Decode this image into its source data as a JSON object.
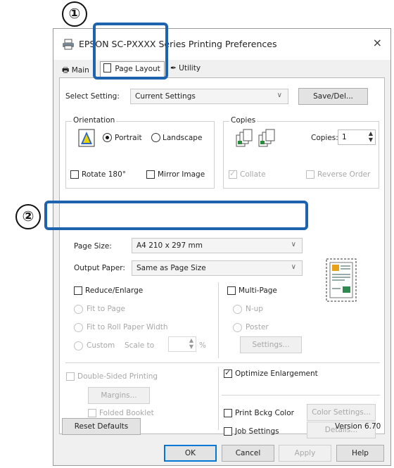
{
  "callouts": {
    "one": "①",
    "two": "②"
  },
  "window": {
    "title": "EPSON SC-PXXXX Series Printing Preferences",
    "close": "×"
  },
  "tabs": [
    {
      "label": "Main"
    },
    {
      "label": "Page Layout"
    },
    {
      "label": "Utility"
    }
  ],
  "select_setting": {
    "label": "Select Setting:",
    "value": "Current Settings",
    "save_button": "Save/Del..."
  },
  "orientation": {
    "title": "Orientation",
    "portrait": "Portrait",
    "landscape": "Landscape",
    "rotate": "Rotate 180°",
    "mirror": "Mirror Image"
  },
  "copies": {
    "title": "Copies",
    "label": "Copies:",
    "value": "1",
    "collate": "Collate",
    "reverse": "Reverse Order"
  },
  "page_size": {
    "label": "Page Size:",
    "value": "A4 210 x 297 mm"
  },
  "output_paper": {
    "label": "Output Paper:",
    "value": "Same as Page Size"
  },
  "reduce": {
    "label": "Reduce/Enlarge",
    "fit_page": "Fit to Page",
    "fit_roll": "Fit to Roll Paper Width",
    "custom": "Custom",
    "scale_to": "Scale to",
    "percent": "%"
  },
  "multi_page": {
    "label": "Multi-Page",
    "nup": "N-up",
    "poster": "Poster",
    "settings_button": "Settings..."
  },
  "double_sided": {
    "label": "Double-Sided Printing",
    "margins_button": "Margins...",
    "folded": "Folded Booklet"
  },
  "optimize": {
    "label": "Optimize Enlargement"
  },
  "print_bckg": {
    "label": "Print Bckg Color",
    "button": "Color Settings..."
  },
  "job_settings": {
    "label": "Job Settings",
    "button": "Details..."
  },
  "reset_button": "Reset Defaults",
  "version": "Version 6.70",
  "footer": {
    "ok": "OK",
    "cancel": "Cancel",
    "apply": "Apply",
    "help": "Help"
  },
  "colors": {
    "highlight": "#1e63ad",
    "focus": "#0078d7"
  },
  "icons": [
    "printer-icon",
    "close-icon",
    "page-layout-icon",
    "utility-icon",
    "portrait-icon",
    "collate-icon",
    "preview-icon"
  ]
}
